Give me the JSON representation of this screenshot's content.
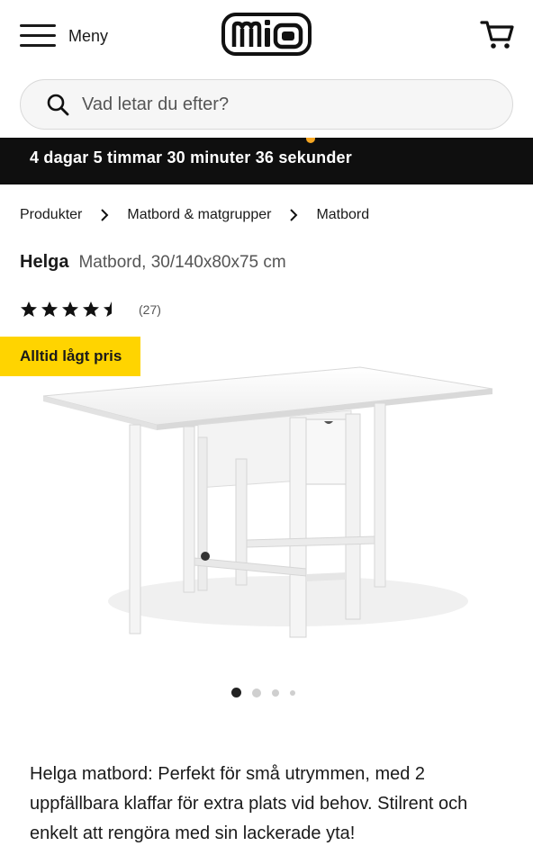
{
  "header": {
    "menu_label": "Meny",
    "logo_text": "mio",
    "cart_icon": "cart-icon"
  },
  "search": {
    "placeholder": "Vad letar du efter?"
  },
  "countdown": {
    "text": "4 dagar 5 timmar 30 minuter 36 sekunder"
  },
  "breadcrumb": {
    "items": [
      "Produkter",
      "Matbord & matgrupper",
      "Matbord"
    ]
  },
  "product": {
    "name": "Helga",
    "description": "Matbord, 30/140x80x75 cm",
    "rating": 4.5,
    "review_count": "(27)",
    "badge": "Alltid lågt pris",
    "image_count": 4,
    "active_image": 1,
    "summary": "Helga matbord: Perfekt för små utrymmen, med 2 uppfällbara klaffar för extra plats vid behov. Stilrent och enkelt att rengöra med sin lackerade yta!"
  },
  "colors": {
    "countdown_bg": "#0f0f0f",
    "badge_bg": "#ffd400",
    "text": "#1a1a1a"
  }
}
